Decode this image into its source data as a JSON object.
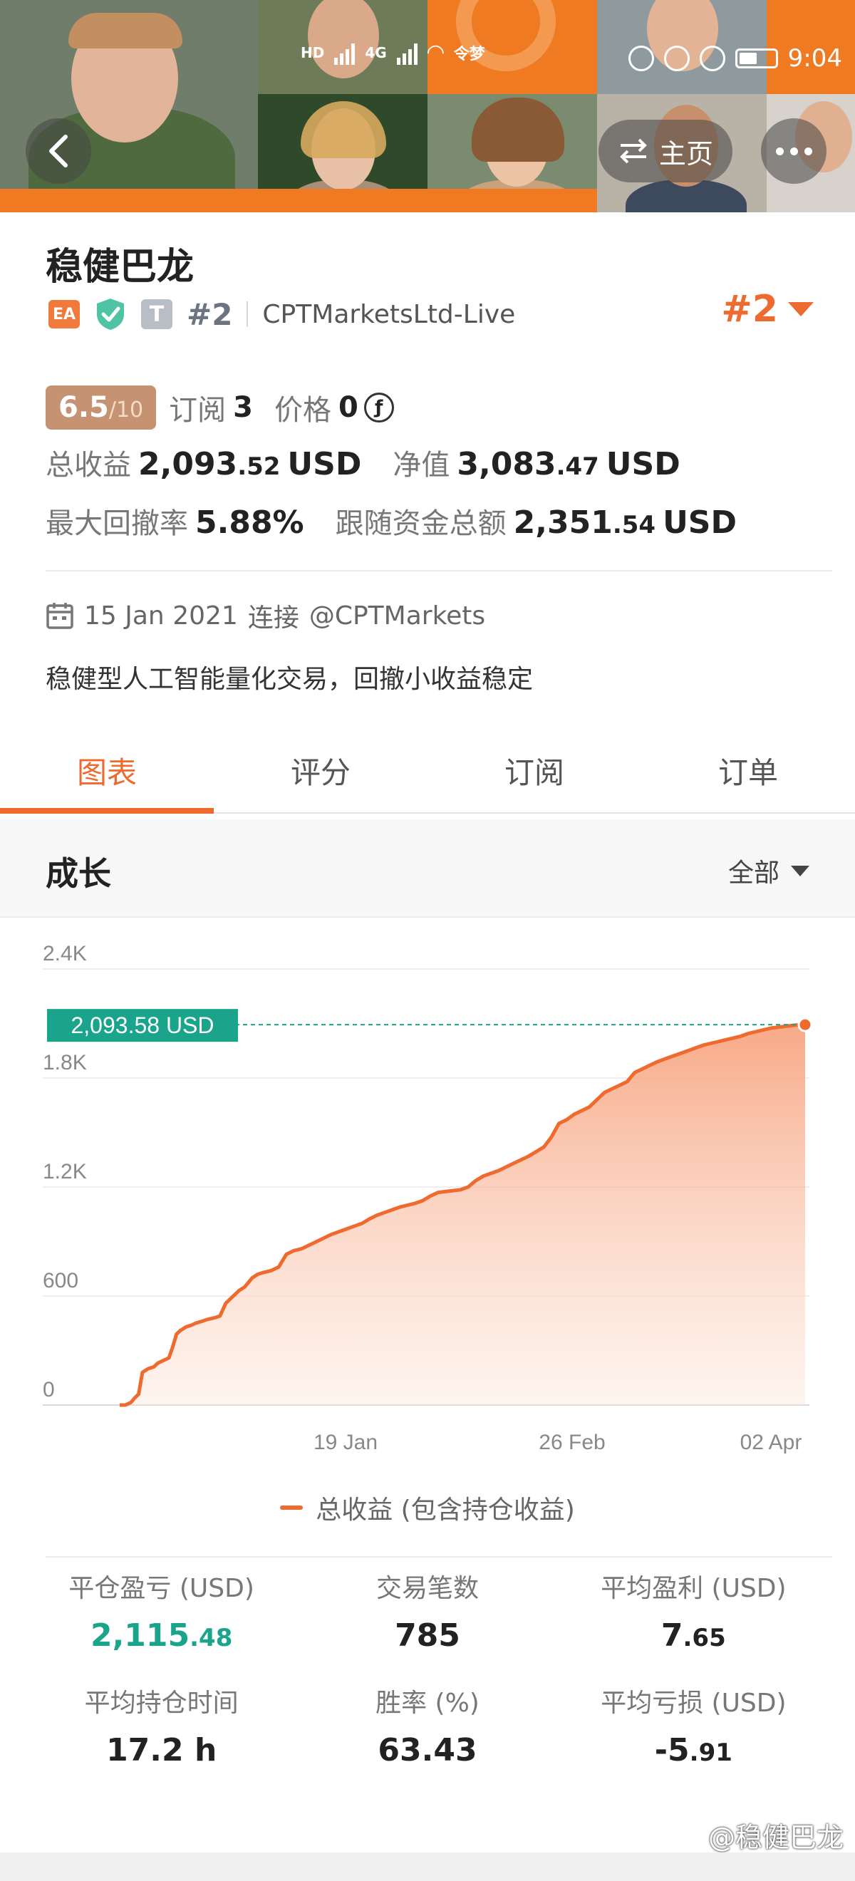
{
  "status_bar": {
    "time": "9:04",
    "network_left": "HD",
    "network_right": "4G",
    "wifi_text": "令梦"
  },
  "header": {
    "home_label": "主页"
  },
  "profile": {
    "name": "稳健巴龙",
    "badge_ea": "EA",
    "badge_t": "T",
    "rank": "#2",
    "broker": "CPTMarketsLtd-Live",
    "rank_right": "#2"
  },
  "score": {
    "value": "6.5",
    "out_of": "/10",
    "subscribe_label": "订阅",
    "subscribe_count": "3",
    "price_label": "价格",
    "price_value": "0",
    "coin_symbol": "ƒ"
  },
  "metrics": {
    "total_profit_label": "总收益",
    "total_profit_int": "2,093",
    "total_profit_dec": ".52",
    "total_profit_unit": "USD",
    "equity_label": "净值",
    "equity_int": "3,083",
    "equity_dec": ".47",
    "equity_unit": "USD",
    "drawdown_label": "最大回撤率",
    "drawdown_value": "5.88%",
    "follow_label": "跟随资金总额",
    "follow_int": "2,351",
    "follow_dec": ".54",
    "follow_unit": "USD"
  },
  "joined": {
    "date": "15 Jan 2021",
    "connect": "连接",
    "account": "@CPTMarkets"
  },
  "description": "稳健型人工智能量化交易，回撤小收益稳定",
  "tabs": [
    {
      "label": "图表",
      "active": true
    },
    {
      "label": "评分",
      "active": false
    },
    {
      "label": "订阅",
      "active": false
    },
    {
      "label": "订单",
      "active": false
    }
  ],
  "growth": {
    "title": "成长",
    "filter": "全部"
  },
  "chart_data": {
    "type": "area",
    "y_ticks": [
      "2.4K",
      "1.8K",
      "1.2K",
      "600",
      "0"
    ],
    "y_tick_values": [
      2400,
      1800,
      1200,
      600,
      0
    ],
    "ylim": [
      0,
      2400
    ],
    "x_ticks": [
      "19 Jan",
      "26 Feb",
      "02 Apr"
    ],
    "current_label": "2,093.58 USD",
    "current_value": 2093.58,
    "legend": "总收益 (包含持仓收益)",
    "line_color": "#ef6a2f",
    "marker_color": "#1aa48c",
    "x_index": [
      0,
      3,
      6,
      8,
      10,
      12,
      15,
      18,
      20,
      22,
      24,
      26,
      28,
      30,
      32,
      35,
      38,
      40,
      43,
      46,
      50,
      53,
      56,
      60,
      63,
      66,
      70,
      73,
      76,
      80,
      84,
      88,
      92,
      96,
      100,
      104,
      108,
      112,
      116,
      120,
      124,
      128,
      132,
      136,
      140,
      144,
      148,
      152,
      156,
      160,
      164,
      168,
      172,
      176,
      180,
      184,
      188,
      192,
      196,
      200,
      204,
      208,
      212,
      216,
      220,
      224,
      228,
      232,
      236,
      240,
      244,
      248,
      252,
      256,
      260,
      264,
      268,
      272,
      276,
      280,
      284,
      288,
      292,
      296,
      300,
      304,
      308,
      312,
      316,
      320,
      324,
      328,
      332,
      336,
      340,
      344,
      348,
      352,
      356,
      360,
      362
    ],
    "values": [
      0,
      0,
      15,
      40,
      60,
      180,
      200,
      210,
      230,
      240,
      250,
      260,
      320,
      390,
      410,
      430,
      440,
      450,
      460,
      470,
      480,
      490,
      560,
      600,
      630,
      650,
      700,
      720,
      730,
      740,
      760,
      830,
      850,
      860,
      880,
      900,
      920,
      940,
      955,
      970,
      985,
      1000,
      1025,
      1045,
      1060,
      1075,
      1090,
      1100,
      1110,
      1125,
      1150,
      1170,
      1175,
      1180,
      1185,
      1200,
      1235,
      1260,
      1275,
      1290,
      1310,
      1330,
      1350,
      1370,
      1395,
      1420,
      1475,
      1550,
      1570,
      1600,
      1620,
      1640,
      1680,
      1720,
      1740,
      1760,
      1780,
      1830,
      1850,
      1870,
      1890,
      1905,
      1920,
      1935,
      1950,
      1965,
      1980,
      1990,
      2000,
      2010,
      2020,
      2030,
      2045,
      2055,
      2065,
      2075,
      2080,
      2085,
      2090,
      2093.58,
      2093.58
    ]
  },
  "stats": [
    {
      "label": "平仓盈亏 (USD)",
      "int": "2,115",
      "dec": ".48",
      "green": true
    },
    {
      "label": "交易笔数",
      "int": "785",
      "dec": "",
      "green": false
    },
    {
      "label": "平均盈利 (USD)",
      "int": "7",
      "dec": ".65",
      "green": false
    },
    {
      "label": "平均持仓时间",
      "int": "17.2 h",
      "dec": "",
      "green": false
    },
    {
      "label": "胜率 (%)",
      "int": "63.43",
      "dec": "",
      "green": false
    },
    {
      "label": "平均亏损 (USD)",
      "int": "-5",
      "dec": ".91",
      "green": false
    }
  ],
  "watermark": "@稳健巴龙"
}
